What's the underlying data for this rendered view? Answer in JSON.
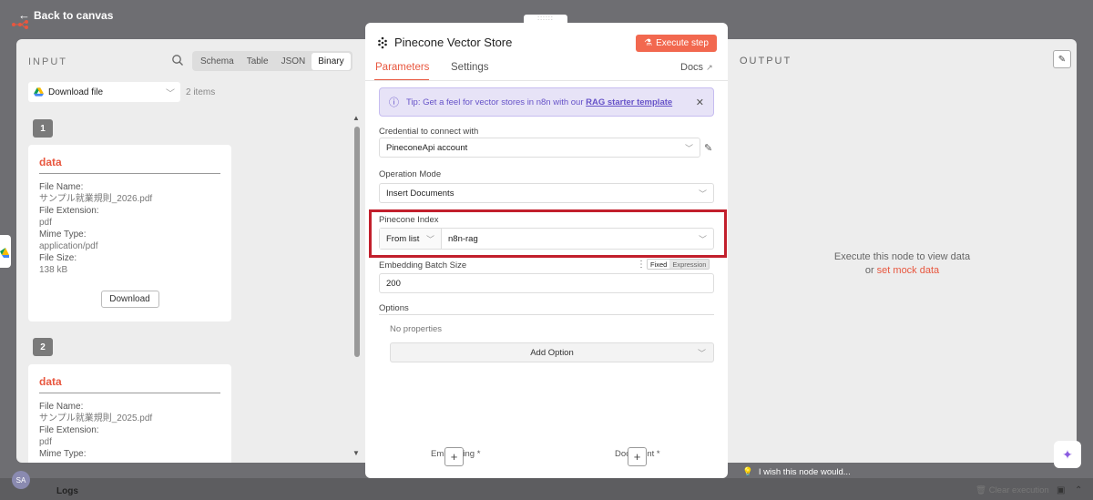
{
  "nav": {
    "back_label": "Back to canvas"
  },
  "input": {
    "title": "INPUT",
    "tabs": [
      "Schema",
      "Table",
      "JSON",
      "Binary"
    ],
    "source": "Download file",
    "count": "2 items",
    "items": [
      {
        "num": "1",
        "title": "data",
        "fields": [
          {
            "label": "File Name:",
            "value": "サンプル就業規則_2026.pdf"
          },
          {
            "label": "File Extension:",
            "value": "pdf"
          },
          {
            "label": "Mime Type:",
            "value": "application/pdf"
          },
          {
            "label": "File Size:",
            "value": "138 kB"
          }
        ],
        "download": "Download"
      },
      {
        "num": "2",
        "title": "data",
        "fields": [
          {
            "label": "File Name:",
            "value": "サンプル就業規則_2025.pdf"
          },
          {
            "label": "File Extension:",
            "value": "pdf"
          },
          {
            "label": "Mime Type:",
            "value": ""
          }
        ]
      }
    ]
  },
  "node": {
    "title": "Pinecone Vector Store",
    "execute_label": "Execute step",
    "tabs": {
      "params": "Parameters",
      "settings": "Settings",
      "docs": "Docs"
    },
    "tip": {
      "text": "Tip: Get a feel for vector stores in n8n with our",
      "link": "RAG starter template"
    },
    "credential": {
      "label": "Credential to connect with",
      "value": "PineconeApi account"
    },
    "operation": {
      "label": "Operation Mode",
      "value": "Insert Documents"
    },
    "index": {
      "label": "Pinecone Index",
      "mode": "From list",
      "value": "n8n-rag"
    },
    "batch": {
      "label": "Embedding Batch Size",
      "fixed": "Fixed",
      "expression": "Expression",
      "value": "200"
    },
    "options": {
      "label": "Options",
      "empty": "No properties",
      "add": "Add Option"
    },
    "connectors": {
      "embedding": "Embedding *",
      "document": "Document *",
      "plus": "+"
    }
  },
  "output": {
    "title": "OUTPUT",
    "msg_line1": "Execute this node to view data",
    "msg_or": "or",
    "msg_link": "set mock data"
  },
  "footer": {
    "wish": "I wish this node would...",
    "logs": "Logs",
    "clear": "Clear execution",
    "avatar": "SA"
  },
  "colors": {
    "accent": "#e8573f",
    "highlight": "#c21f2c",
    "tip_bg": "#e7e3f7"
  }
}
